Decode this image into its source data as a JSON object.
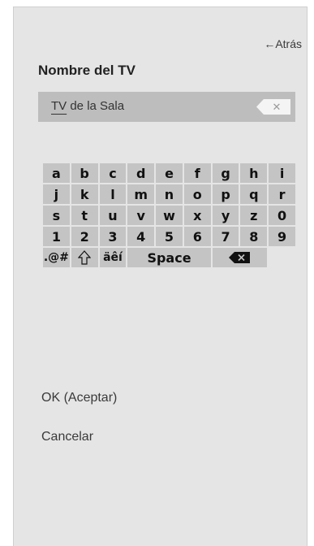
{
  "header": {
    "back_label": "←Atrás",
    "title": "Nombre del TV"
  },
  "name_field": {
    "value_first": "TV",
    "value_rest": " de la Sala",
    "clear_icon": "close-icon"
  },
  "keyboard": {
    "rows": [
      [
        "a",
        "b",
        "c",
        "d",
        "e",
        "f",
        "g",
        "h",
        "i"
      ],
      [
        "j",
        "k",
        "l",
        "m",
        "n",
        "o",
        "p",
        "q",
        "r"
      ],
      [
        "s",
        "t",
        "u",
        "v",
        "w",
        "x",
        "y",
        "z",
        "0"
      ],
      [
        "1",
        "2",
        "3",
        "4",
        "5",
        "6",
        "7",
        "8",
        "9"
      ]
    ],
    "symbols_label": ".@#",
    "shift_icon": "shift-arrow-icon",
    "accents_label": "äêí",
    "space_label": "Space",
    "backspace_icon": "backspace-icon"
  },
  "actions": {
    "ok_label": "OK (Aceptar)",
    "cancel_label": "Cancelar"
  },
  "colors": {
    "panel_bg": "#e5e5e5",
    "input_bg": "#bdbdbd",
    "key_bg": "#c4c4c4"
  }
}
